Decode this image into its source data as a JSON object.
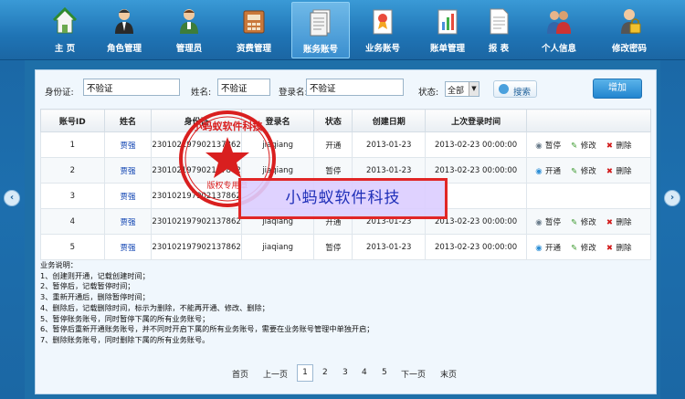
{
  "nav": [
    {
      "label": "主 页",
      "icon": "home-icon"
    },
    {
      "label": "角色管理",
      "icon": "role-icon"
    },
    {
      "label": "管理员",
      "icon": "admin-icon"
    },
    {
      "label": "资费管理",
      "icon": "fee-icon"
    },
    {
      "label": "账务账号",
      "icon": "account-icon",
      "active": true
    },
    {
      "label": "业务账号",
      "icon": "service-icon"
    },
    {
      "label": "账单管理",
      "icon": "bill-icon"
    },
    {
      "label": "报 表",
      "icon": "report-icon"
    },
    {
      "label": "个人信息",
      "icon": "person-icon"
    },
    {
      "label": "修改密码",
      "icon": "lock-icon"
    }
  ],
  "search": {
    "idcard_label": "身份证:",
    "idcard_value": "不验证",
    "name_label": "姓名:",
    "name_value": "不验证",
    "login_label": "登录名:",
    "login_value": "不验证",
    "status_label": "状态:",
    "status_value": "全部",
    "search_label": "搜索",
    "add_label": "增加"
  },
  "table": {
    "headers": [
      "账号ID",
      "姓名",
      "身份证",
      "登录名",
      "状态",
      "创建日期",
      "上次登录时间",
      ""
    ],
    "rows": [
      {
        "id": "1",
        "name": "贾强",
        "idcard": "230102197902137862",
        "login": "jiaqiang",
        "status": "开通",
        "created": "2013-01-23",
        "last": "2013-02-23 00:00:00",
        "ops": [
          "暂停",
          "修改",
          "删除"
        ]
      },
      {
        "id": "2",
        "name": "贾强",
        "idcard": "230102197902137862",
        "login": "jiaqiang",
        "status": "暂停",
        "created": "2013-01-23",
        "last": "2013-02-23 00:00:00",
        "ops": [
          "开通",
          "修改",
          "删除"
        ]
      },
      {
        "id": "3",
        "name": "贾强",
        "idcard": "230102197902137862",
        "login": "",
        "status": "",
        "created": "",
        "last": "",
        "ops": []
      },
      {
        "id": "4",
        "name": "贾强",
        "idcard": "230102197902137862",
        "login": "jiaqiang",
        "status": "开通",
        "created": "2013-01-23",
        "last": "2013-02-23 00:00:00",
        "ops": [
          "暂停",
          "修改",
          "删除"
        ]
      },
      {
        "id": "5",
        "name": "贾强",
        "idcard": "230102197902137862",
        "login": "jiaqiang",
        "status": "暂停",
        "created": "2013-01-23",
        "last": "2013-02-23 00:00:00",
        "ops": [
          "开通",
          "修改",
          "删除"
        ]
      }
    ]
  },
  "notes": [
    "业务说明：",
    "1、创建则开通，记载创建时间；",
    "2、暂停后，记载暂停时间；",
    "3、重新开通后，删除暂停时间；",
    "4、删除后，记载删除时间，标示为删除，不能再开通、修改、删除；",
    "5、暂停账务账号，同时暂停下属的所有业务账号；",
    "6、暂停后重新开通账务账号，并不同时开启下属的所有业务账号，需要在业务账号管理中单独开启；",
    "7、删除账务账号，同时删除下属的所有业务账号。"
  ],
  "pager": {
    "first": "首页",
    "prev": "上一页",
    "pages": [
      "1",
      "2",
      "3",
      "4",
      "5"
    ],
    "current": "1",
    "next": "下一页",
    "last": "末页"
  },
  "stamp": {
    "text": "小蚂蚁软件科技",
    "sub": "版权专用章"
  },
  "watermark": "小蚂蚁软件科技",
  "colors": {
    "accent": "#1f74b5",
    "link": "#0a3fb0",
    "delete": "#d21b1b",
    "edit": "#3c9a2e"
  }
}
